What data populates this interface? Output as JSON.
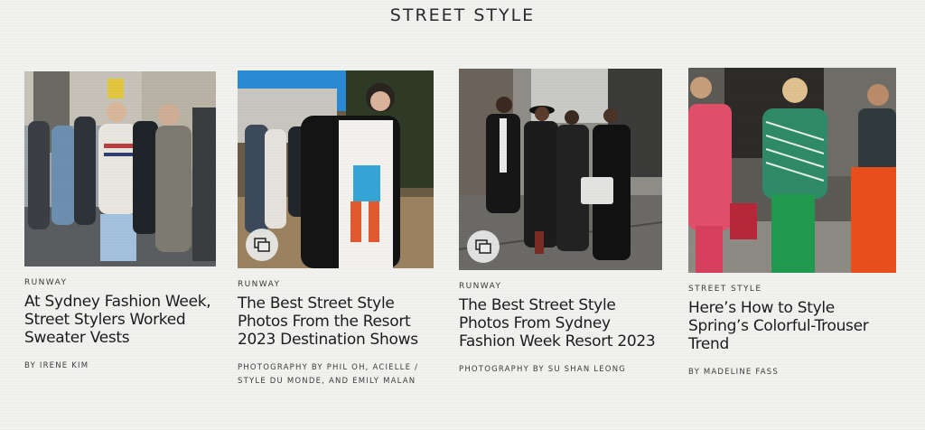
{
  "section": {
    "title": "STREET STYLE"
  },
  "cards": [
    {
      "rubric": "RUNWAY",
      "headline": "At Sydney Fashion Week, Street Stylers Worked Sweater Vests",
      "byline": "BY IRENE KIM",
      "has_gallery_icon": false,
      "image_icon": "photo-crowd-sweater-vest"
    },
    {
      "rubric": "RUNWAY",
      "headline": "The Best Street Style Photos From the Resort 2023 Destination Shows",
      "byline": "PHOTOGRAPHY BY PHIL OH, ACIELLE / STYLE DU MONDE, AND EMILY MALAN",
      "has_gallery_icon": true,
      "image_icon": "photo-woman-graphic-tee"
    },
    {
      "rubric": "RUNWAY",
      "headline": "The Best Street Style Photos From Sydney Fashion Week Resort 2023",
      "byline": "PHOTOGRAPHY BY SU SHAN LEONG",
      "has_gallery_icon": true,
      "image_icon": "photo-group-black-outfits"
    },
    {
      "rubric": "STREET STYLE",
      "headline": "Here’s How to Style Spring’s Colorful-Trouser Trend",
      "byline": "BY MADELINE FASS",
      "has_gallery_icon": false,
      "image_icon": "photo-colorful-trousers"
    }
  ],
  "colors": {
    "background": "#f1f1ef",
    "text": "#1c1c1c",
    "badge": "#ececec"
  }
}
